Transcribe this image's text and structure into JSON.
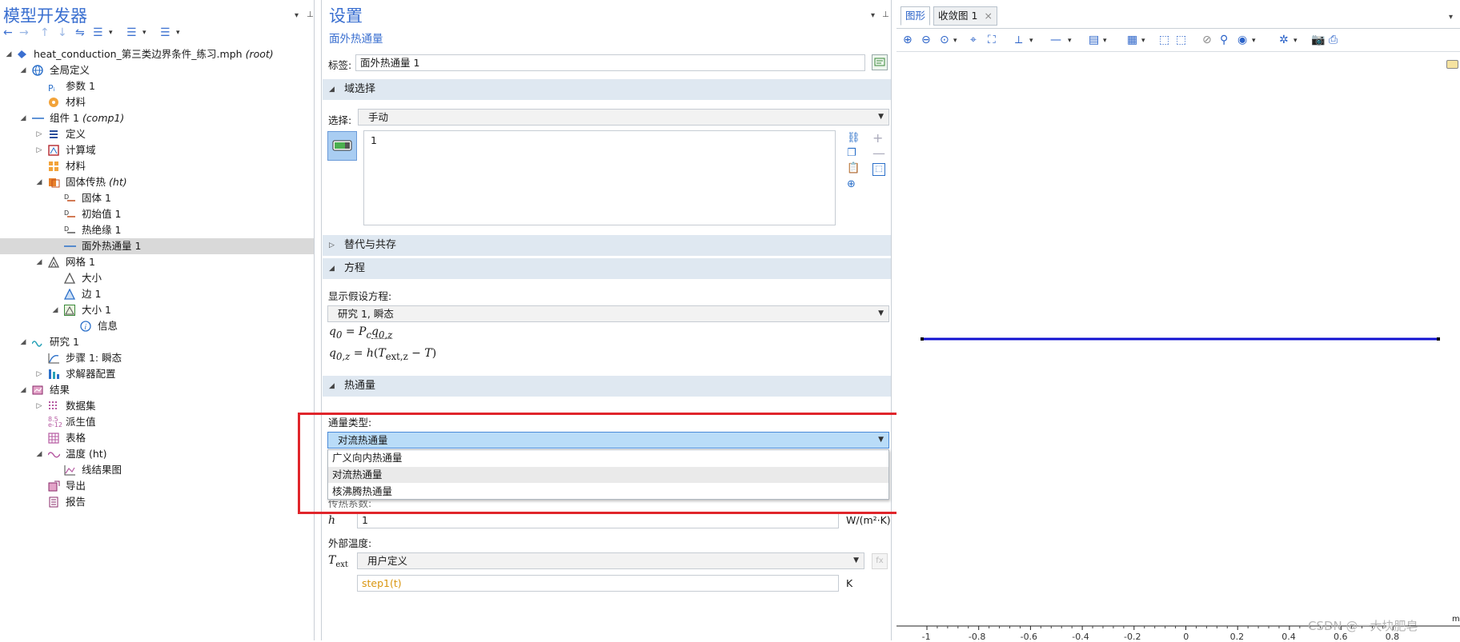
{
  "left": {
    "title": "模型开发器",
    "tree": [
      {
        "label": "heat_conduction_第三类边界条件_练习.mph",
        "suffix": "(root)",
        "icon": "model-root-icon"
      },
      {
        "label": "全局定义",
        "suffix": "",
        "icon": "globe-icon"
      },
      {
        "label": "参数 1",
        "suffix": "",
        "icon": "parameters-icon"
      },
      {
        "label": "材料",
        "suffix": "",
        "icon": "material-icon"
      },
      {
        "label": "组件 1",
        "suffix": "(comp1)",
        "icon": "component-icon"
      },
      {
        "label": "定义",
        "suffix": "",
        "icon": "definitions-icon"
      },
      {
        "label": "计算域",
        "suffix": "",
        "icon": "geometry-icon"
      },
      {
        "label": "材料",
        "suffix": "",
        "icon": "material-icon"
      },
      {
        "label": "固体传热",
        "suffix": "(ht)",
        "icon": "heat-transfer-icon"
      },
      {
        "label": "固体 1",
        "suffix": "",
        "icon": "node-icon"
      },
      {
        "label": "初始值 1",
        "suffix": "",
        "icon": "node-icon"
      },
      {
        "label": "热绝缘 1",
        "suffix": "",
        "icon": "node-icon"
      },
      {
        "label": "面外热通量 1",
        "suffix": "",
        "icon": "line-icon"
      },
      {
        "label": "网格 1",
        "suffix": "",
        "icon": "mesh-icon"
      },
      {
        "label": "大小",
        "suffix": "",
        "icon": "mesh-size-icon"
      },
      {
        "label": "边 1",
        "suffix": "",
        "icon": "mesh-edge-icon"
      },
      {
        "label": "大小 1",
        "suffix": "",
        "icon": "mesh-size-icon"
      },
      {
        "label": "信息",
        "suffix": "",
        "icon": "info-icon"
      },
      {
        "label": "研究 1",
        "suffix": "",
        "icon": "study-icon"
      },
      {
        "label": "步骤 1: 瞬态",
        "suffix": "",
        "icon": "transient-step-icon"
      },
      {
        "label": "求解器配置",
        "suffix": "",
        "icon": "solver-icon"
      },
      {
        "label": "结果",
        "suffix": "",
        "icon": "results-icon"
      },
      {
        "label": "数据集",
        "suffix": "",
        "icon": "dataset-icon"
      },
      {
        "label": "派生值",
        "suffix": "",
        "icon": "derived-values-icon"
      },
      {
        "label": "表格",
        "suffix": "",
        "icon": "table-icon"
      },
      {
        "label": "温度 (ht)",
        "suffix": "",
        "icon": "plot-group-icon"
      },
      {
        "label": "线结果图",
        "suffix": "",
        "icon": "line-graph-icon"
      },
      {
        "label": "导出",
        "suffix": "",
        "icon": "export-icon"
      },
      {
        "label": "报告",
        "suffix": "",
        "icon": "report-icon"
      }
    ]
  },
  "settings": {
    "title": "设置",
    "subtitle": "面外热通量",
    "label_caption": "标签:",
    "label_value": "面外热通量 1",
    "sections": {
      "domain": "域选择",
      "override": "替代与共存",
      "equation": "方程",
      "heatflux": "热通量"
    },
    "selection_caption": "选择:",
    "selection_value": "手动",
    "selection_list": [
      "1"
    ],
    "equation_caption": "显示假设方程:",
    "equation_value": "研究 1, 瞬态",
    "flux_type_caption": "通量类型:",
    "flux_type_value": "对流热通量",
    "flux_options": [
      "广义向内热通量",
      "对流热通量",
      "核沸腾热通量"
    ],
    "htc_caption": "传热系数:",
    "h_symbol": "h",
    "h_value": "1",
    "h_unit": "W/(m²·K)",
    "ext_temp_caption": "外部温度:",
    "text_symbol": "T",
    "text_sub": "ext",
    "text_mode": "用户定义",
    "text_value": "step1(t)",
    "text_unit": "K"
  },
  "graphics": {
    "tabs": [
      "图形",
      "收敛图 1"
    ],
    "x_ticks": [
      "-1",
      "-0.8",
      "-0.6",
      "-0.4",
      "-0.2",
      "0",
      "0.2",
      "0.4",
      "0.6",
      "0.8"
    ],
    "x_unit": "m",
    "line_color": "#1010d0"
  },
  "watermark": "CSDN @一大块肥皂",
  "colors": {
    "accent": "#3a6fd0",
    "highlight": "#e0252b",
    "section_bg": "#dfe8f1"
  }
}
